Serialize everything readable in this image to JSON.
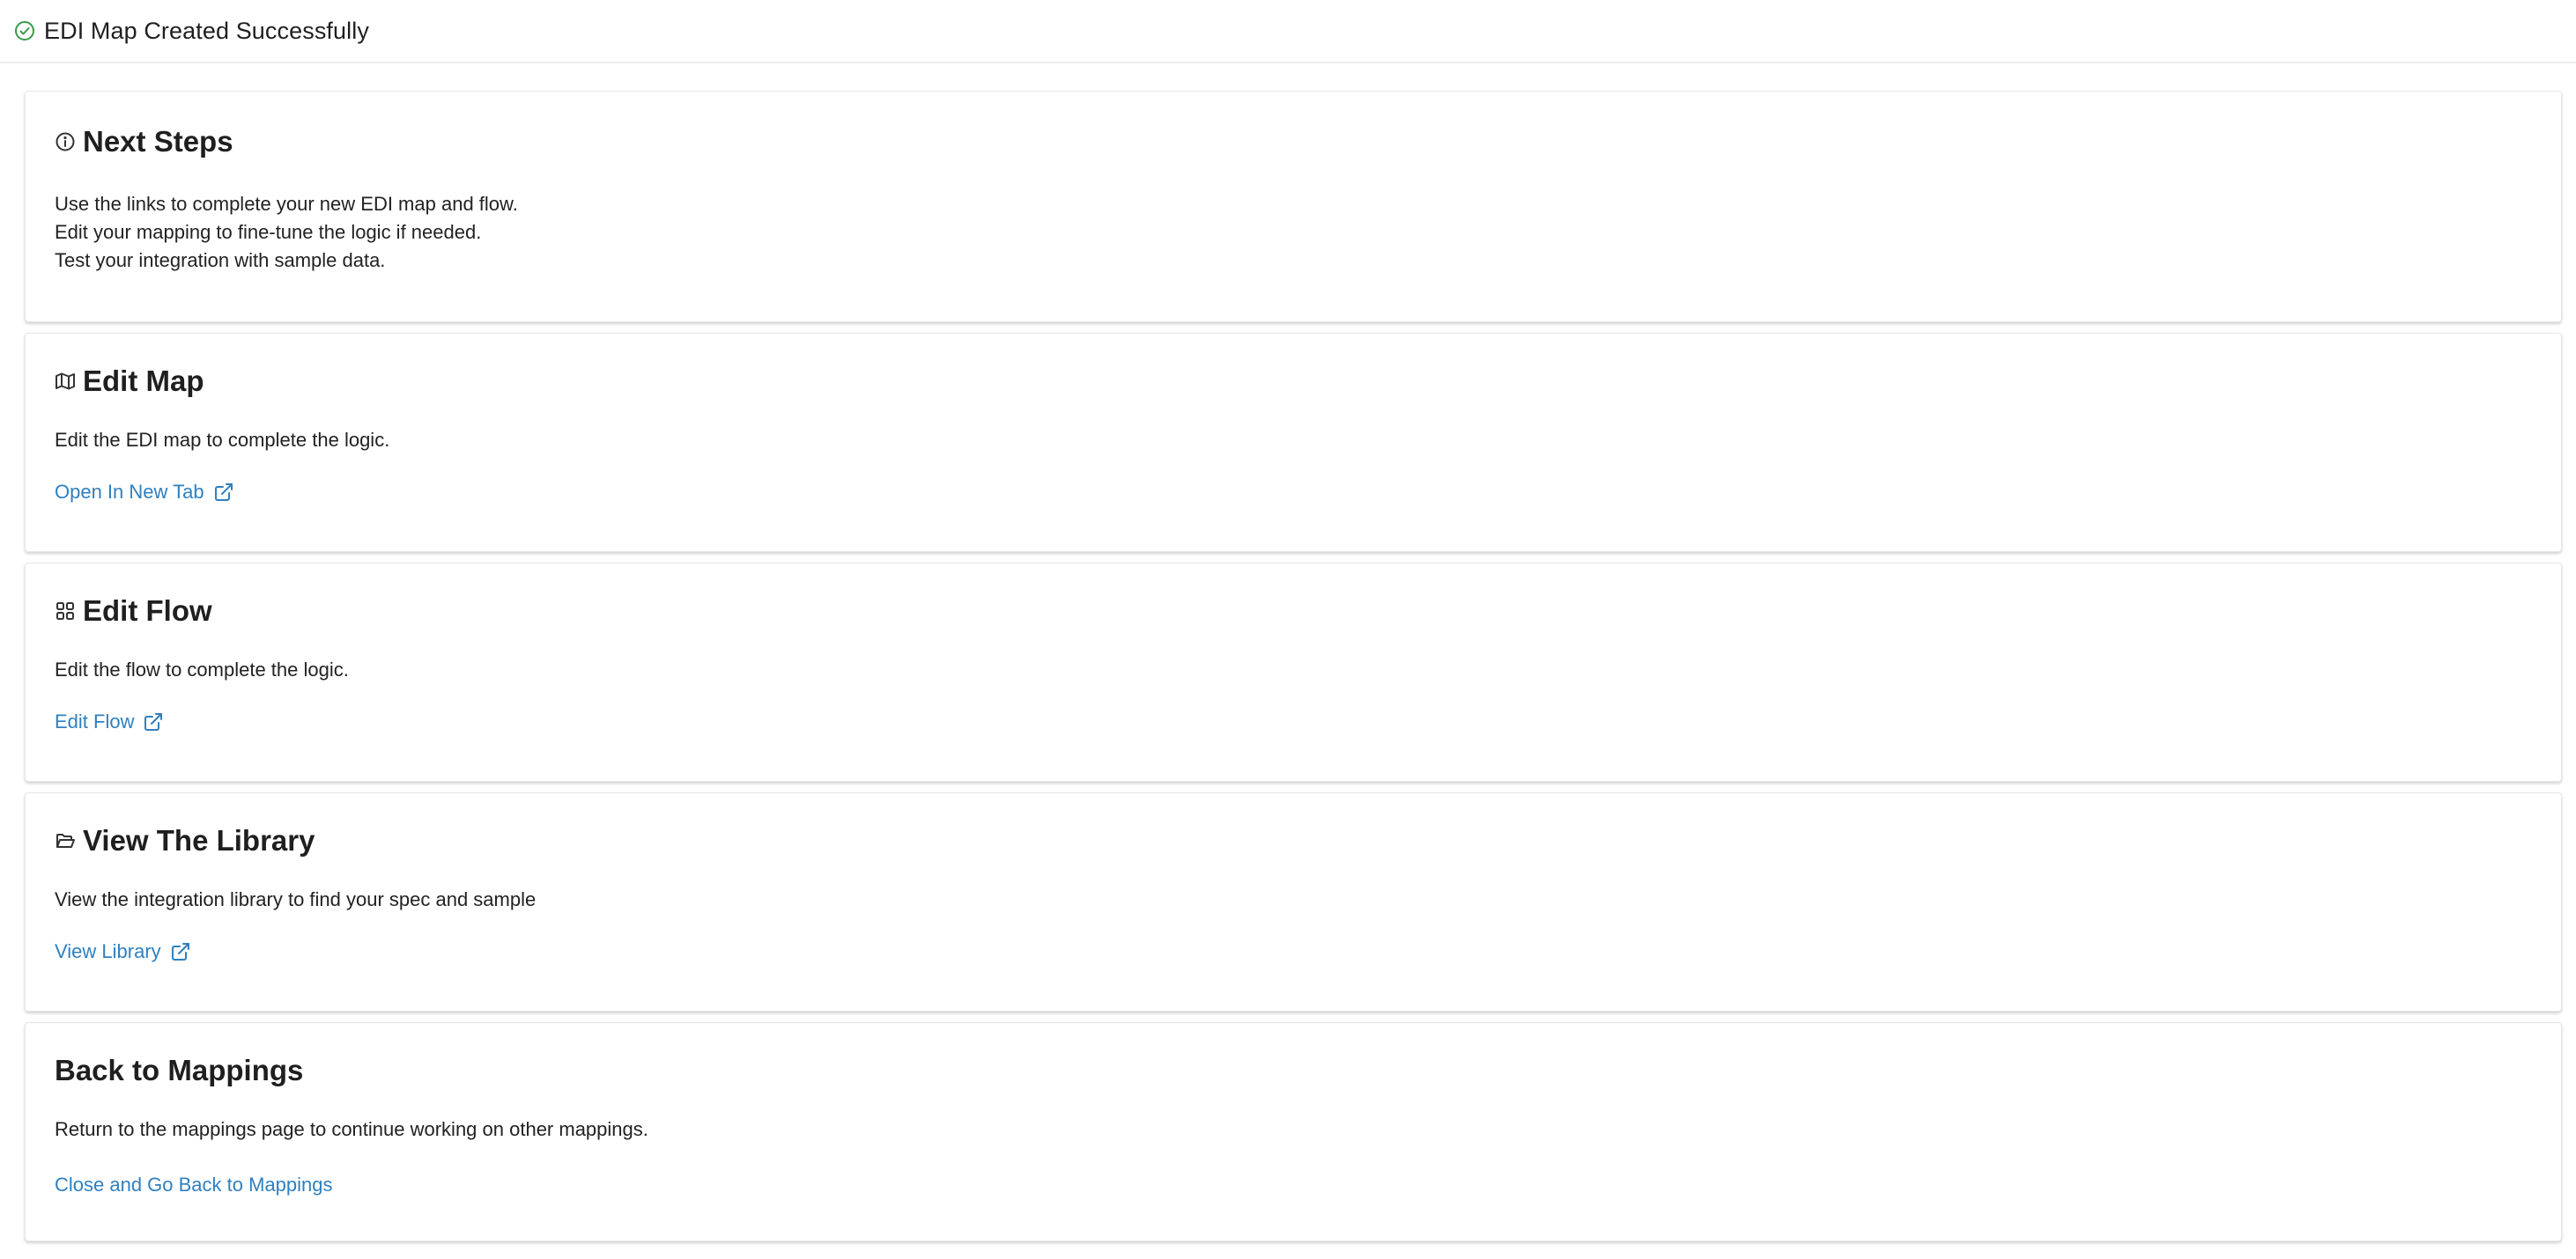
{
  "header": {
    "title": "EDI Map Created Successfully",
    "icon": "check-circle-icon",
    "icon_color": "#3a9a4a"
  },
  "colors": {
    "link": "#2f80c0",
    "text": "#1f1f1f"
  },
  "cards": {
    "next_steps": {
      "title": "Next Steps",
      "icon": "info-icon",
      "lines": [
        "Use the links to complete your new EDI map and flow.",
        "Edit your mapping to fine-tune the logic if needed.",
        "Test your integration with sample data."
      ]
    },
    "edit_map": {
      "title": "Edit Map",
      "icon": "map-icon",
      "description": "Edit the EDI map to complete the logic.",
      "link_label": "Open In New Tab",
      "link_icon": "external-link-icon"
    },
    "edit_flow": {
      "title": "Edit Flow",
      "icon": "grid-icon",
      "description": "Edit the flow to complete the logic.",
      "link_label": "Edit Flow",
      "link_icon": "external-link-icon"
    },
    "library": {
      "title": "View The Library",
      "icon": "folder-open-icon",
      "description": "View the integration library to find your spec and sample",
      "link_label": "View Library",
      "link_icon": "external-link-icon"
    },
    "back": {
      "title": "Back to Mappings",
      "description": "Return to the mappings page to continue working on other mappings.",
      "link_label": "Close and Go Back to Mappings"
    }
  }
}
